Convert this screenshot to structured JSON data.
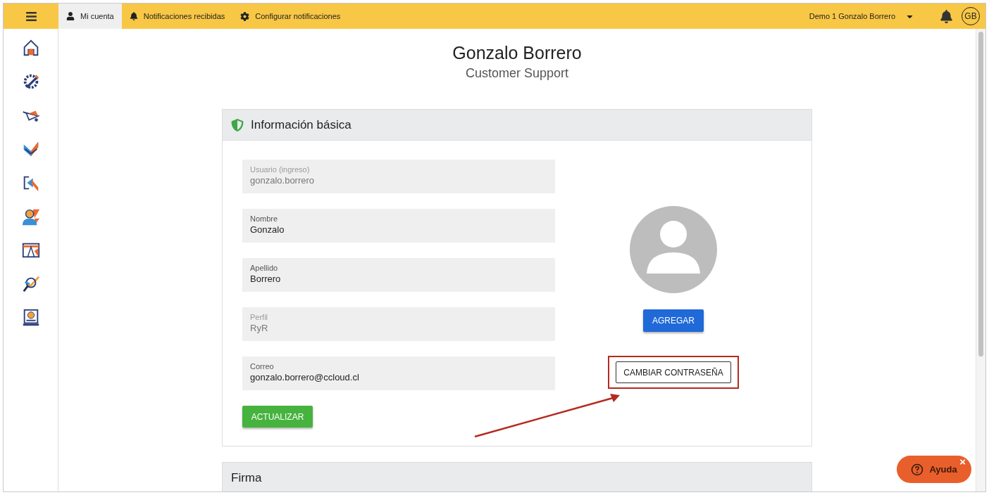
{
  "top_bar": {
    "tabs": [
      {
        "label": "Mi cuenta",
        "selected": true
      },
      {
        "label": "Notificaciones recibidas",
        "selected": false
      },
      {
        "label": "Configurar notificaciones",
        "selected": false
      }
    ],
    "account": "Demo 1 Gonzalo Borrero",
    "avatar_initials": "GB"
  },
  "profile": {
    "name": "Gonzalo Borrero",
    "role": "Customer Support"
  },
  "basic_info": {
    "title": "Información básica",
    "fields": [
      {
        "label": "Usuario (ingreso)",
        "value": "gonzalo.borrero",
        "disabled": true
      },
      {
        "label": "Nombre",
        "value": "Gonzalo",
        "disabled": false
      },
      {
        "label": "Apellido",
        "value": "Borrero",
        "disabled": false
      },
      {
        "label": "Perfil",
        "value": "RyR",
        "disabled": true
      },
      {
        "label": "Correo",
        "value": "gonzalo.borrero@ccloud.cl",
        "disabled": false
      }
    ],
    "update_button": "ACTUALIZAR",
    "add_button": "AGREGAR",
    "password_button": "CAMBIAR CONTRASEÑA"
  },
  "signature": {
    "title": "Firma"
  },
  "help_button": {
    "label": "Ayuda",
    "close": "×"
  }
}
